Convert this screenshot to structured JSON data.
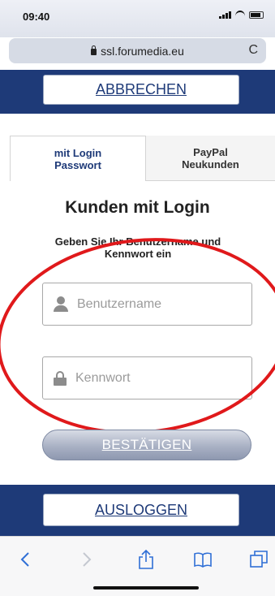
{
  "status_bar": {
    "time": "09:40"
  },
  "url_bar": {
    "domain": "ssl.forumedia.eu",
    "reload_glyph": "C"
  },
  "top": {
    "cancel_label": "ABBRECHEN"
  },
  "tabs": [
    {
      "line1": "mit Login",
      "line2": "Passwort",
      "active": true
    },
    {
      "line1": "PayPal",
      "line2": "Neukunden",
      "active": false
    }
  ],
  "login": {
    "heading": "Kunden mit Login",
    "subtitle": "Geben Sie Ihr Benutzername und Kennwort ein",
    "username_placeholder": "Benutzername",
    "password_placeholder": "Kennwort",
    "confirm_label": "BESTÄTIGEN"
  },
  "bottom": {
    "logout_label": "AUSLOGGEN"
  },
  "colors": {
    "navy": "#1e3a78",
    "annotation_red": "#e0191b"
  },
  "toolbar_icons": [
    "back-icon",
    "forward-icon",
    "share-icon",
    "bookmarks-icon",
    "tabs-icon"
  ]
}
